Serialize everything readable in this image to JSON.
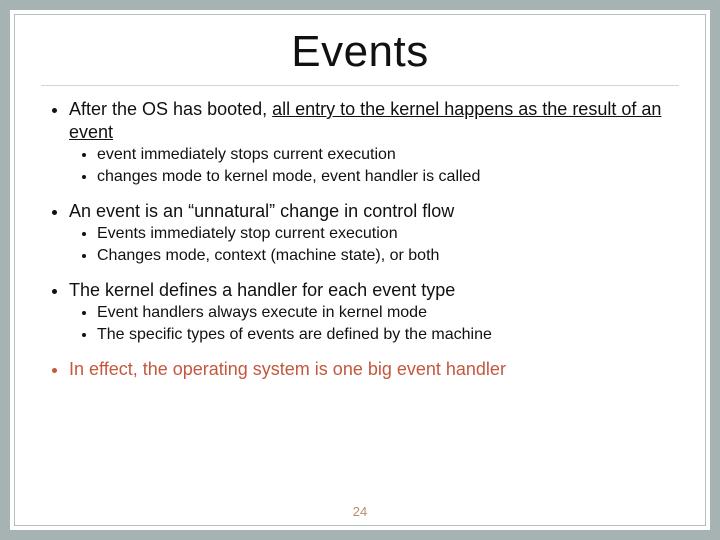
{
  "title": "Events",
  "page_number": "24",
  "bullets": [
    {
      "lead": "After the OS has booted, ",
      "emph": "all entry to the kernel happens as the result of an event",
      "subs": [
        "event immediately stops current execution",
        "changes mode to kernel mode, event handler is called"
      ]
    },
    {
      "lead": "An event is an “unnatural” change in control flow",
      "emph": "",
      "subs": [
        "Events immediately stop current execution",
        "Changes mode, context (machine state), or both"
      ]
    },
    {
      "lead": "The kernel defines a handler for each event type",
      "emph": "",
      "subs": [
        "Event handlers always execute in kernel mode",
        "The specific types of events are defined by the machine"
      ]
    },
    {
      "lead": "In effect, the operating system is one big event handler",
      "emph": "",
      "subs": [],
      "accent": true
    }
  ]
}
